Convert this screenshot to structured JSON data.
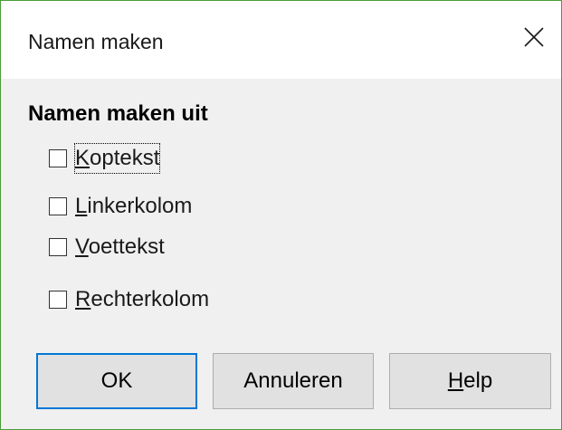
{
  "window": {
    "title": "Namen maken"
  },
  "section": {
    "heading": "Namen maken uit"
  },
  "options": [
    {
      "mnemonic": "K",
      "rest": "optekst",
      "checked": false,
      "focused": true
    },
    {
      "mnemonic": "L",
      "rest": "inkerkolom",
      "checked": false,
      "focused": false
    },
    {
      "mnemonic": "V",
      "rest": "oettekst",
      "checked": false,
      "focused": false
    },
    {
      "mnemonic": "R",
      "rest": "echterkolom",
      "checked": false,
      "focused": false
    }
  ],
  "buttons": {
    "ok": "OK",
    "cancel": "Annuleren",
    "help_mnemonic": "H",
    "help_rest": "elp"
  },
  "colors": {
    "window_border": "#4a9d3a",
    "default_button_border": "#0078d7",
    "dialog_background": "#f0f0f0"
  }
}
